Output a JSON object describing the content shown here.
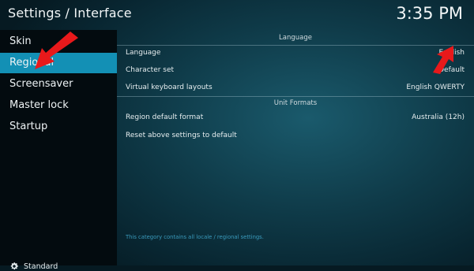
{
  "header": {
    "title": "Settings / Interface",
    "clock": "3:35 PM"
  },
  "sidebar": {
    "items": [
      {
        "label": "Skin"
      },
      {
        "label": "Regional"
      },
      {
        "label": "Screensaver"
      },
      {
        "label": "Master lock"
      },
      {
        "label": "Startup"
      }
    ],
    "active_index": 1,
    "profile_label": "Standard"
  },
  "content": {
    "sections": {
      "language": "Language",
      "unit_formats": "Unit Formats"
    },
    "settings": [
      {
        "label": "Language",
        "value": "English"
      },
      {
        "label": "Character set",
        "value": "Default"
      },
      {
        "label": "Virtual keyboard layouts",
        "value": "English QWERTY"
      },
      {
        "label": "Region default format",
        "value": "Australia (12h)"
      },
      {
        "label": "Reset above settings to default",
        "value": ""
      }
    ],
    "hint": "This category contains all locale / regional settings."
  },
  "colors": {
    "accent": "#1390b5",
    "annotation": "#e8191b"
  },
  "icons": {
    "profile": "gear-icon",
    "annotations": [
      "arrow-icon",
      "arrow-icon"
    ]
  }
}
